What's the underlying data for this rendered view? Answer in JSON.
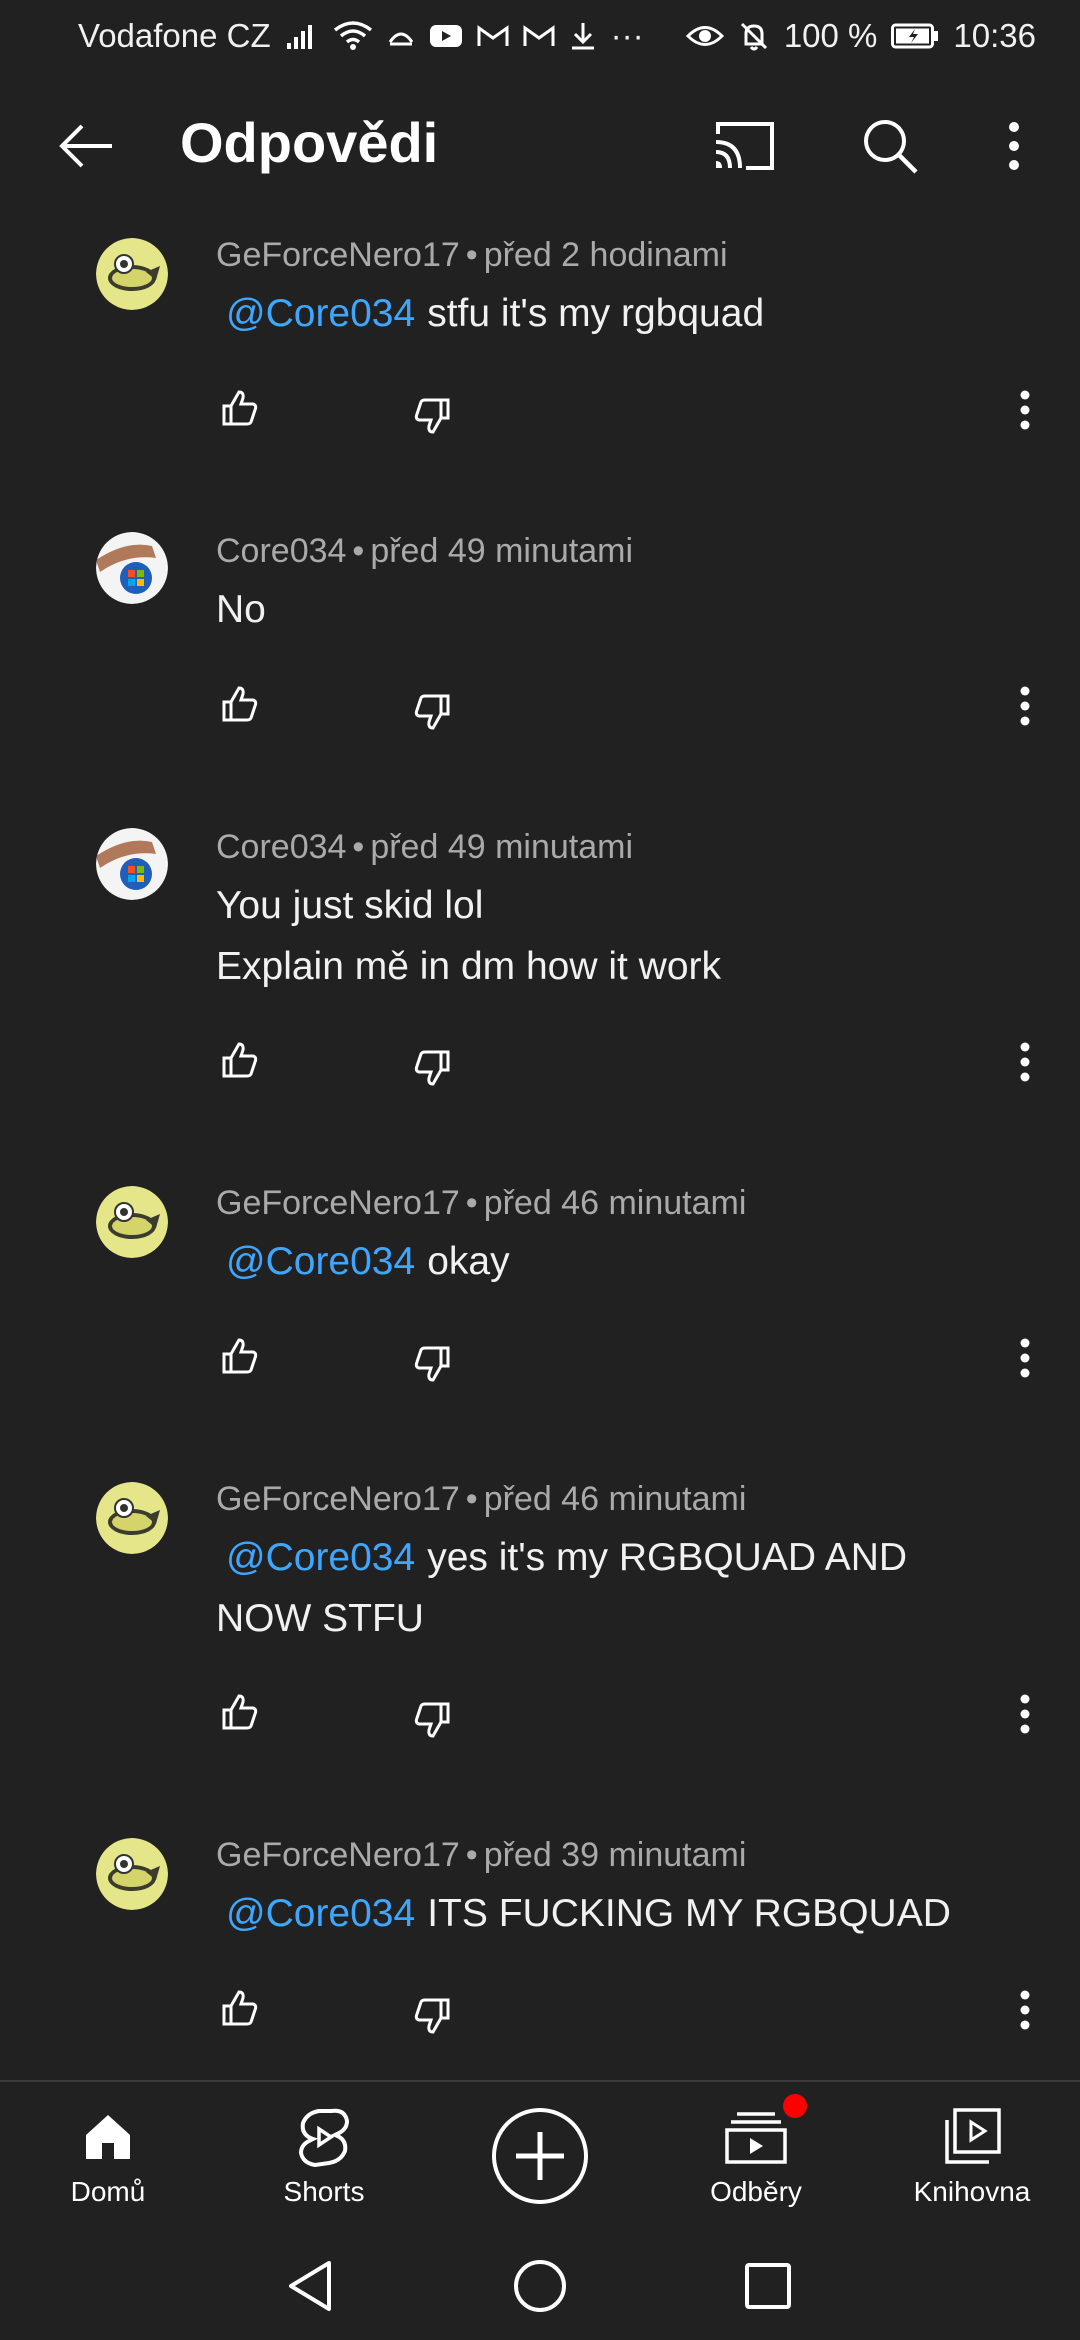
{
  "status_bar": {
    "carrier": "Vodafone CZ",
    "overflow_indicator": "···",
    "battery": "100 %",
    "time": "10:36"
  },
  "app_bar": {
    "title": "Odpovědi",
    "icons": [
      "back-arrow-icon",
      "cast-icon",
      "search-icon",
      "more-vertical-icon"
    ]
  },
  "comments": [
    {
      "author": "GeForceNero17",
      "separator": "•",
      "time": "před 2 hodinami",
      "mention": "@Core034",
      "lines": [
        "stfu it's my rgbquad"
      ],
      "avatar": "fish-logo"
    },
    {
      "author": "Core034",
      "separator": "•",
      "time": "před 49 minutami",
      "mention": "",
      "lines": [
        "No"
      ],
      "avatar": "windows-hand"
    },
    {
      "author": "Core034",
      "separator": "•",
      "time": "před 49 minutami",
      "mention": "",
      "lines": [
        "You just skid lol",
        "Explain mě in dm how it work"
      ],
      "avatar": "windows-hand"
    },
    {
      "author": "GeForceNero17",
      "separator": "•",
      "time": "před 46 minutami",
      "mention": "@Core034",
      "lines": [
        "okay"
      ],
      "avatar": "fish-logo"
    },
    {
      "author": "GeForceNero17",
      "separator": "•",
      "time": "před 46 minutami",
      "mention": "@Core034",
      "lines": [
        "yes it's my RGBQUAD AND",
        "NOW STFU"
      ],
      "avatar": "fish-logo"
    },
    {
      "author": "GeForceNero17",
      "separator": "•",
      "time": "před 39 minutami",
      "mention": "@Core034",
      "lines": [
        "ITS FUCKING MY RGBQUAD"
      ],
      "avatar": "fish-logo"
    }
  ],
  "bottom_nav": {
    "items": [
      {
        "label": "Domů",
        "icon": "home-icon"
      },
      {
        "label": "Shorts",
        "icon": "shorts-icon"
      },
      {
        "label": "",
        "icon": "create-plus-icon"
      },
      {
        "label": "Odběry",
        "icon": "subscriptions-icon"
      },
      {
        "label": "Knihovna",
        "icon": "library-icon"
      }
    ]
  },
  "colors": {
    "background": "#212121",
    "text": "#f1f1f1",
    "meta": "#aaaaaa",
    "mention": "#3ea6ff",
    "notification": "#ff0000"
  }
}
